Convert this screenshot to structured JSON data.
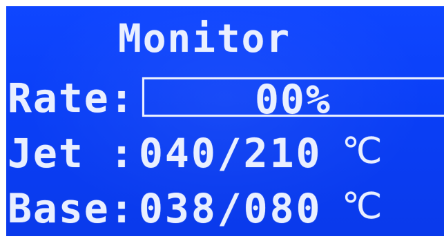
{
  "screen": {
    "title": "Monitor",
    "background_color": "#0a40f5",
    "text_color": "#e9efff"
  },
  "rate": {
    "label": "Rate:",
    "value_text": "00%",
    "progress": 0
  },
  "jet": {
    "label": "Jet :",
    "value": "040/210",
    "unit": "℃",
    "current_temp": 40,
    "target_temp": 210
  },
  "base": {
    "label": "Base:",
    "value": "038/080",
    "unit": "℃",
    "current_temp": 38,
    "target_temp": 80
  }
}
